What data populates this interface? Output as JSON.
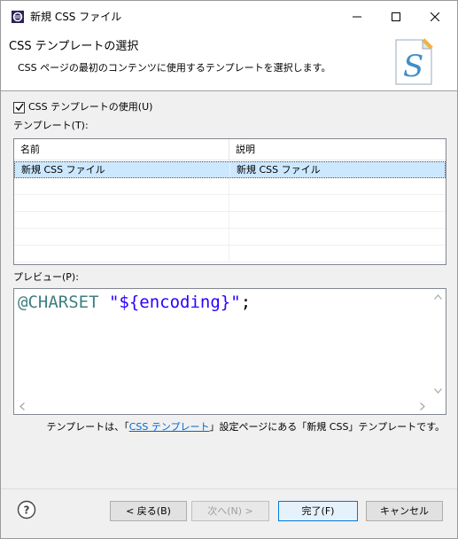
{
  "window": {
    "title": "新規 CSS ファイル"
  },
  "banner": {
    "title": "CSS テンプレートの選択",
    "description": "CSS ページの最初のコンテンツに使用するテンプレートを選択します。",
    "icon": "css-s-file-icon"
  },
  "use_template": {
    "label": "CSS テンプレートの使用(U)",
    "checked": true
  },
  "templates": {
    "label": "テンプレート(T):",
    "columns": [
      "名前",
      "説明"
    ],
    "rows": [
      {
        "name": "新規 CSS ファイル",
        "description": "新規 CSS ファイル",
        "selected": true
      }
    ]
  },
  "preview": {
    "label": "プレビュー(P):",
    "code_at": "@CHARSET",
    "code_string": "\"${encoding}\"",
    "code_semicolon": ";"
  },
  "hint": {
    "prefix": "テンプレートは、「",
    "link": "CSS テンプレート",
    "suffix": "」設定ページにある「新規 CSS」テンプレートです。"
  },
  "buttons": {
    "back": "< 戻る(B)",
    "next": "次へ(N) >",
    "finish": "完了(F)",
    "cancel": "キャンセル"
  },
  "colors": {
    "selection": "#cce8ff",
    "link": "#0066cc",
    "code_keyword": "#3f7f7f",
    "code_string": "#2a00ff",
    "default_button_border": "#0078d7"
  }
}
